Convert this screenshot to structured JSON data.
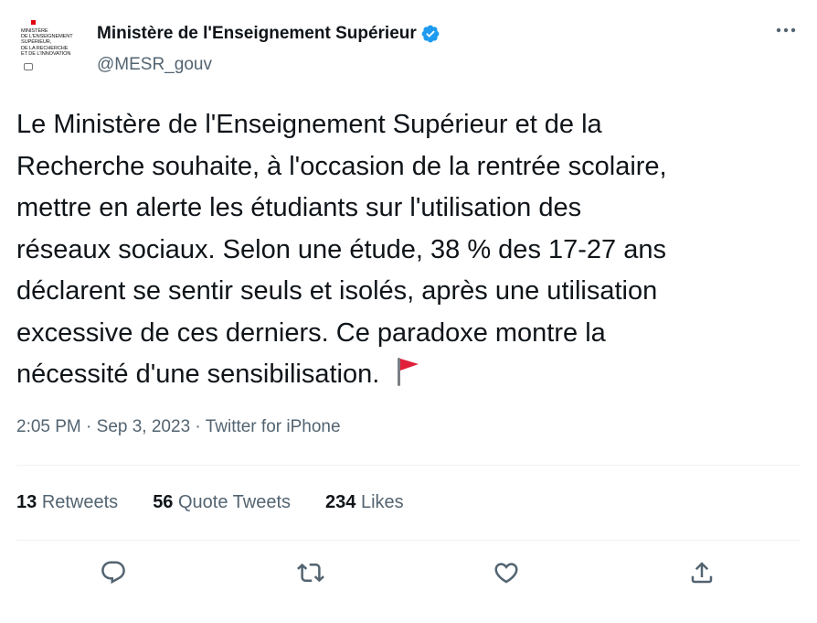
{
  "account": {
    "display_name": "Ministère de l'Enseignement Supérieur",
    "handle": "@MESR_gouv",
    "avatar_lines": [
      "MINISTÈRE",
      "DE L'ENSEIGNEMENT",
      "SUPÉRIEUR,",
      "DE LA RECHERCHE",
      "ET DE L'INNOVATION"
    ],
    "verified_color": "#1d9bf0"
  },
  "tweet": {
    "lines": [
      "Le Ministère de l'Enseignement Supérieur et de la",
      "Recherche souhaite, à l'occasion de la rentrée scolaire,",
      "mettre en alerte les étudiants sur l'utilisation des",
      "réseaux sociaux. Selon une étude, 38 % des 17-27 ans",
      "déclarent se sentir seuls et isolés, après une utilisation",
      "excessive de ces derniers. Ce paradoxe montre la",
      "nécessité d'une sensibilisation."
    ],
    "emoji": "triangular-flag"
  },
  "meta": {
    "time": "2:05 PM",
    "separator": "·",
    "date": "Sep 3, 2023",
    "source": "Twitter for iPhone"
  },
  "stats": {
    "retweets_count": "13",
    "retweets_label": "Retweets",
    "quotes_count": "56",
    "quotes_label": "Quote Tweets",
    "likes_count": "234",
    "likes_label": "Likes"
  },
  "actions": [
    "reply-icon",
    "retweet-icon",
    "like-icon",
    "share-icon"
  ],
  "colors": {
    "text": "#0f1419",
    "secondary": "#536471",
    "divider": "#eff3f4",
    "flag_red": "#e0203a"
  }
}
